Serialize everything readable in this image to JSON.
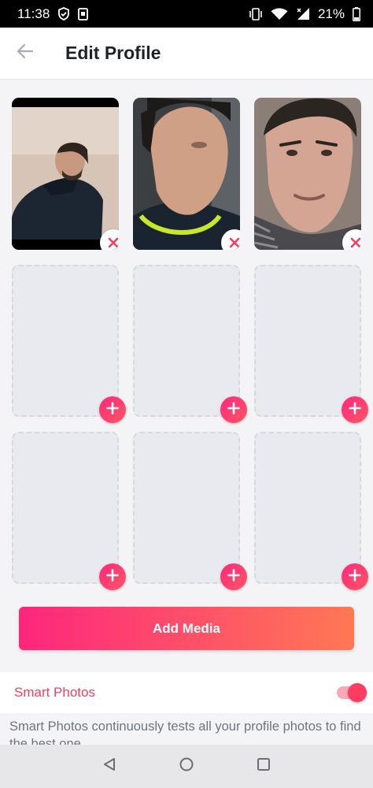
{
  "status_bar": {
    "time": "11:38",
    "battery": "21%",
    "icons": [
      "vpn-shield-icon",
      "screenshot-icon",
      "vibrate-icon",
      "wifi-icon",
      "signal-icon",
      "battery-icon"
    ]
  },
  "header": {
    "back_icon": "arrow-left-icon",
    "title": "Edit Profile"
  },
  "media_grid": {
    "photos": [
      {
        "slot": 1,
        "filled": true,
        "action_icon": "close-icon"
      },
      {
        "slot": 2,
        "filled": true,
        "action_icon": "close-icon"
      },
      {
        "slot": 3,
        "filled": true,
        "action_icon": "close-icon"
      }
    ],
    "empty_slots": [
      4,
      5,
      6,
      7,
      8,
      9
    ],
    "empty_action_icon": "plus-icon"
  },
  "add_media": {
    "label": "Add Media"
  },
  "smart_photos": {
    "label": "Smart Photos",
    "enabled": true,
    "description": "Smart Photos continuously tests all your profile photos to find the best one."
  },
  "nav_bar": {
    "icons": [
      "back-triangle-icon",
      "home-circle-icon",
      "recents-square-icon"
    ]
  },
  "colors": {
    "accent": "#fd267d",
    "accent_end": "#ff7854",
    "smart_label": "#f23e5f",
    "empty_tile": "#e8eaef"
  }
}
